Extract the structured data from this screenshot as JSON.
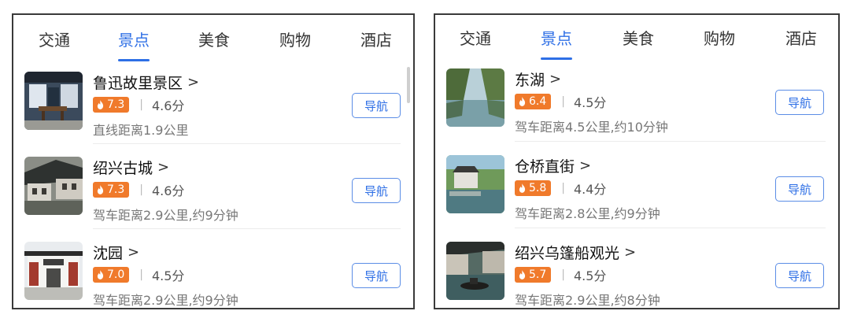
{
  "colors": {
    "accent": "#2e6fe6",
    "heat": "#f07a2b",
    "border": "#3a3a3a"
  },
  "panels": [
    {
      "tabs": [
        {
          "label": "交通",
          "active": false
        },
        {
          "label": "景点",
          "active": true
        },
        {
          "label": "美食",
          "active": false
        },
        {
          "label": "购物",
          "active": false
        },
        {
          "label": "酒店",
          "active": false
        }
      ],
      "items": [
        {
          "name": "鲁迅故里景区",
          "heat": "7.3",
          "score": "4.6分",
          "distance": "直线距离1.9公里",
          "nav": "导航",
          "thumb_icon": "courtyard-photo"
        },
        {
          "name": "绍兴古城",
          "heat": "7.3",
          "score": "4.6分",
          "distance": "驾车距离2.9公里,约9分钟",
          "nav": "导航",
          "thumb_icon": "ancient-city-photo"
        },
        {
          "name": "沈园",
          "heat": "7.0",
          "score": "4.5分",
          "distance": "驾车距离2.9公里,约9分钟",
          "nav": "导航",
          "thumb_icon": "garden-gate-photo"
        }
      ]
    },
    {
      "tabs": [
        {
          "label": "交通",
          "active": false
        },
        {
          "label": "景点",
          "active": true
        },
        {
          "label": "美食",
          "active": false
        },
        {
          "label": "购物",
          "active": false
        },
        {
          "label": "酒店",
          "active": false
        }
      ],
      "items": [
        {
          "name": "东湖",
          "heat": "6.4",
          "score": "4.5分",
          "distance": "驾车距离4.5公里,约10分钟",
          "nav": "导航",
          "thumb_icon": "lake-photo"
        },
        {
          "name": "仓桥直街",
          "heat": "5.8",
          "score": "4.4分",
          "distance": "驾车距离2.8公里,约9分钟",
          "nav": "导航",
          "thumb_icon": "canal-street-photo"
        },
        {
          "name": "绍兴乌篷船观光",
          "heat": "5.7",
          "score": "4.5分",
          "distance": "驾车距离2.9公里,约8分钟",
          "nav": "导航",
          "thumb_icon": "boat-tour-photo"
        }
      ]
    }
  ]
}
